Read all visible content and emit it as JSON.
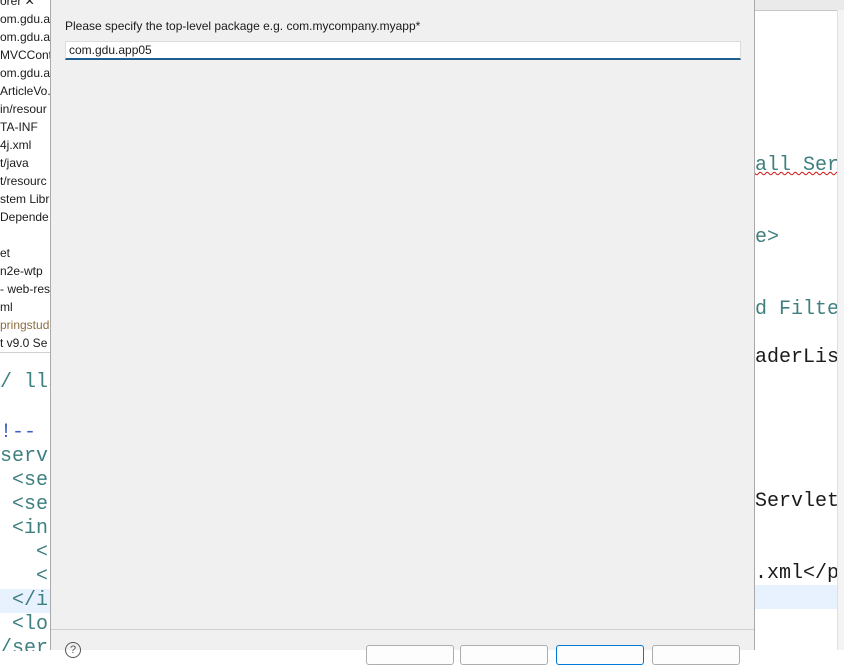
{
  "project_tree": {
    "items": [
      "orer  ✕",
      "om.gdu.a",
      "om.gdu.a",
      "MVCCont",
      "om.gdu.a",
      "ArticleVo.",
      "in/resour",
      "TA-INF",
      "4j.xml",
      "t/java",
      "t/resourc",
      "stem Libr",
      "Depende",
      "",
      "et",
      "n2e-wtp",
      "- web-res",
      "ml",
      "pringstud",
      "t v9.0 Se"
    ]
  },
  "left_code": {
    "lines": [
      "/ lls",
      "",
      "!--",
      "serv",
      " <se",
      " <se",
      " <in",
      "   <",
      "   <",
      " </i",
      " <lo",
      "/ser"
    ]
  },
  "right_code": {
    "lines": [
      "",
      "",
      "",
      "",
      "",
      "",
      "all Ser",
      "",
      "",
      "e>",
      "",
      "",
      "d Filte",
      "",
      "aderLis",
      "",
      "",
      "",
      "",
      "",
      "Servlet",
      "",
      "",
      ".xml</p",
      "",
      ""
    ]
  },
  "dialog": {
    "prompt": "Please specify the top-level package e.g. com.mycompany.myapp*",
    "package_value": "com.gdu.app05",
    "help_glyph": "?"
  }
}
